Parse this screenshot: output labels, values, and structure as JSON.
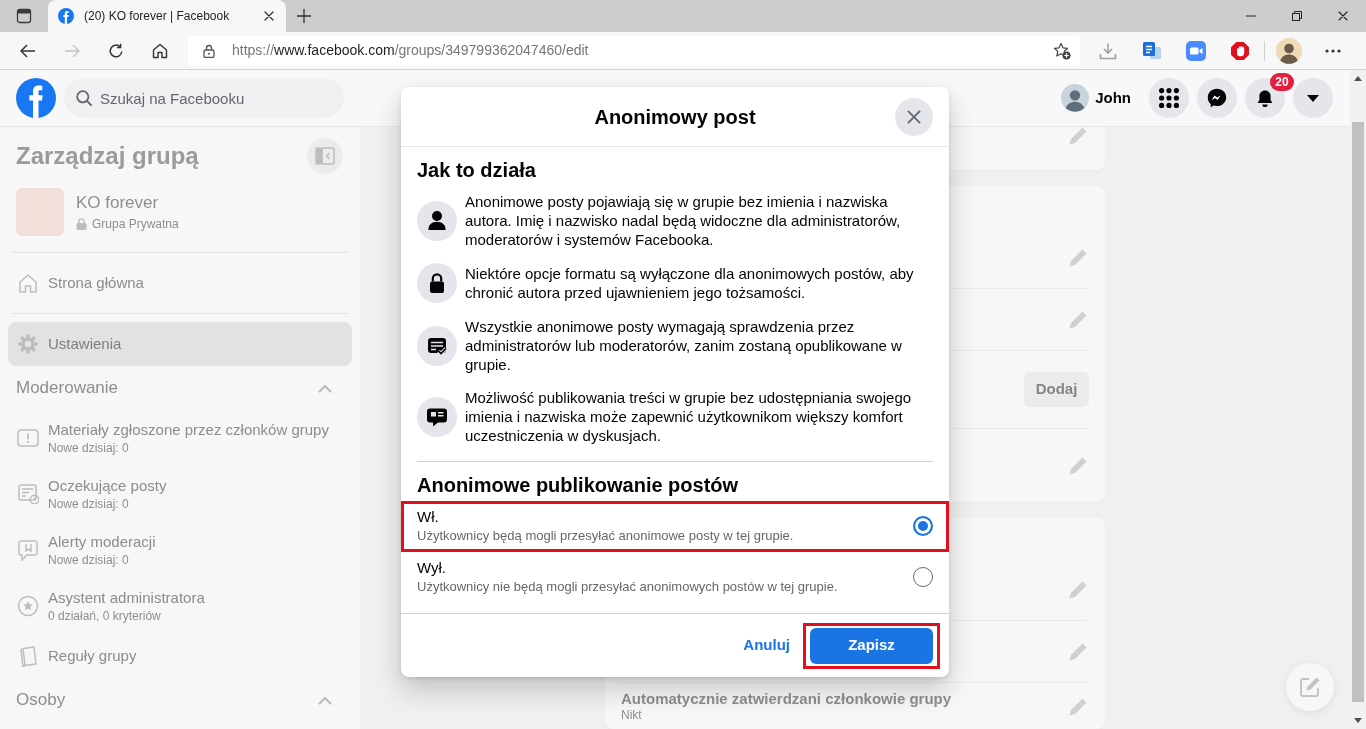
{
  "browser": {
    "tabs": [
      {
        "title": "(20) KO forever | Facebook",
        "selected": true
      }
    ],
    "address": {
      "scheme": "https://",
      "host": "www.facebook.com",
      "path": "/groups/349799362047460/edit"
    },
    "forward_disabled": true
  },
  "top_bar": {
    "search_placeholder": "Szukaj na Facebooku",
    "user_name": "John",
    "notification_count": "20"
  },
  "sidebar": {
    "title": "Zarządzaj grupą",
    "group": {
      "name": "KO forever",
      "privacy": "Grupa Prywatna"
    },
    "nav": [
      {
        "label": "Strona główna",
        "selected": false
      },
      {
        "label": "Ustawienia",
        "selected": true
      }
    ],
    "sections": [
      {
        "title": "Moderowanie",
        "expanded": true,
        "items": [
          {
            "label": "Materiały zgłoszone przez członków grupy",
            "detail": "Nowe dzisiaj: 0"
          },
          {
            "label": "Oczekujące posty",
            "detail": "Nowe dzisiaj: 0"
          },
          {
            "label": "Alerty moderacji",
            "detail": "Nowe dzisiaj: 0"
          },
          {
            "label": "Asystent administratora",
            "detail": "0 działań, 0 kryteriów"
          },
          {
            "label": "Reguły grupy"
          }
        ]
      },
      {
        "title": "Osoby",
        "expanded": true
      }
    ]
  },
  "main": {
    "cards": [
      {
        "rows": [
          {
            "kind": "edit"
          }
        ]
      },
      {
        "rows": [
          {
            "kind": "edit"
          },
          {
            "kind": "edit"
          },
          {
            "kind": "add",
            "button_label": "Dodaj"
          },
          {
            "kind": "edit"
          }
        ]
      },
      {
        "rows": [
          {
            "kind": "edit"
          },
          {
            "kind": "edit"
          },
          {
            "kind": "edit",
            "title": "Automatycznie zatwierdzani członkowie grupy",
            "value": "Nikt"
          }
        ]
      }
    ]
  },
  "dialog": {
    "title": "Anonimowy post",
    "info_heading": "Jak to działa",
    "info_items": [
      {
        "text": "Anonimowe posty pojawiają się w grupie bez imienia i nazwiska autora. Imię i nazwisko nadal będą widoczne dla administratorów, moderatorów i systemów Facebooka."
      },
      {
        "text": "Niektóre opcje formatu są wyłączone dla anonimowych postów, aby chronić autora przed ujawnieniem jego tożsamości."
      },
      {
        "text": "Wszystkie anonimowe posty wymagają sprawdzenia przez administratorów lub moderatorów, zanim zostaną opublikowane w grupie."
      },
      {
        "text": "Możliwość publikowania treści w grupie bez udostępniania swojego imienia i nazwiska może zapewnić użytkownikom większy komfort uczestniczenia w dyskusjach."
      }
    ],
    "setting_heading": "Anonimowe publikowanie postów",
    "options": [
      {
        "label": "Wł.",
        "description": "Użytkownicy będą mogli przesyłać anonimowe posty w tej grupie.",
        "selected": true,
        "highlighted": true
      },
      {
        "label": "Wył.",
        "description": "Użytkownicy nie będą mogli przesyłać anonimowych postów w tej grupie.",
        "selected": false,
        "highlighted": false
      }
    ],
    "cancel_label": "Anuluj",
    "save_label": "Zapisz",
    "save_highlighted": true
  }
}
